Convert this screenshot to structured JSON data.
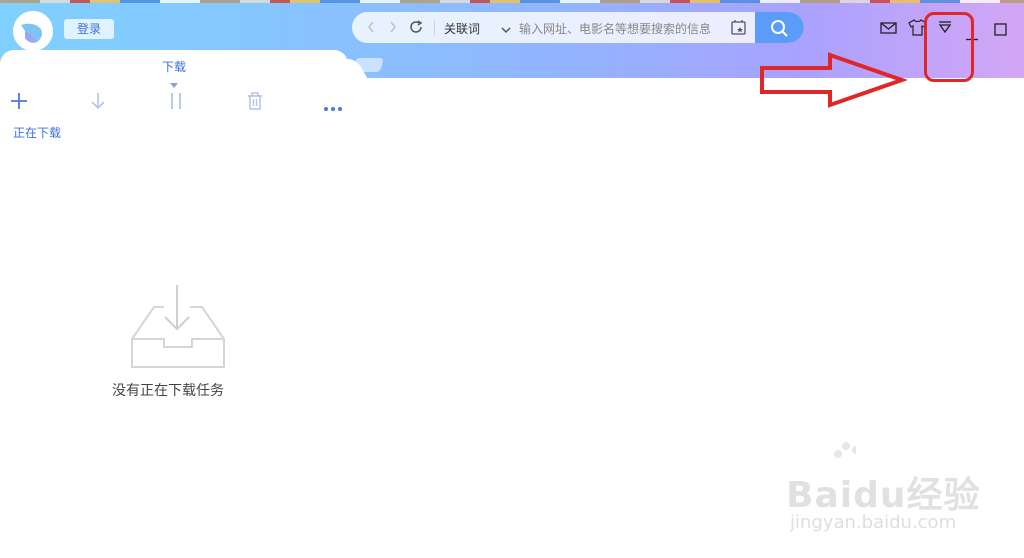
{
  "header": {
    "login_label": "登录",
    "address_bar": {
      "mode_label": "关联词",
      "placeholder": "输入网址、电影名等想要搜索的信息"
    }
  },
  "tabs": [
    {
      "label": "下载",
      "active": true
    }
  ],
  "toolbar": {
    "icons": [
      "add-icon",
      "download-arrow-icon",
      "pause-icon",
      "trash-icon",
      "more-icon"
    ]
  },
  "main": {
    "section_label": "正在下载",
    "empty_message": "没有正在下载任务"
  },
  "watermark": {
    "brand": "Baidu经验",
    "url": "jingyan.baidu.com"
  },
  "colors": {
    "accent": "#3d6fd8",
    "search_button": "#5a9cf8",
    "annotation_red": "#e02626"
  }
}
